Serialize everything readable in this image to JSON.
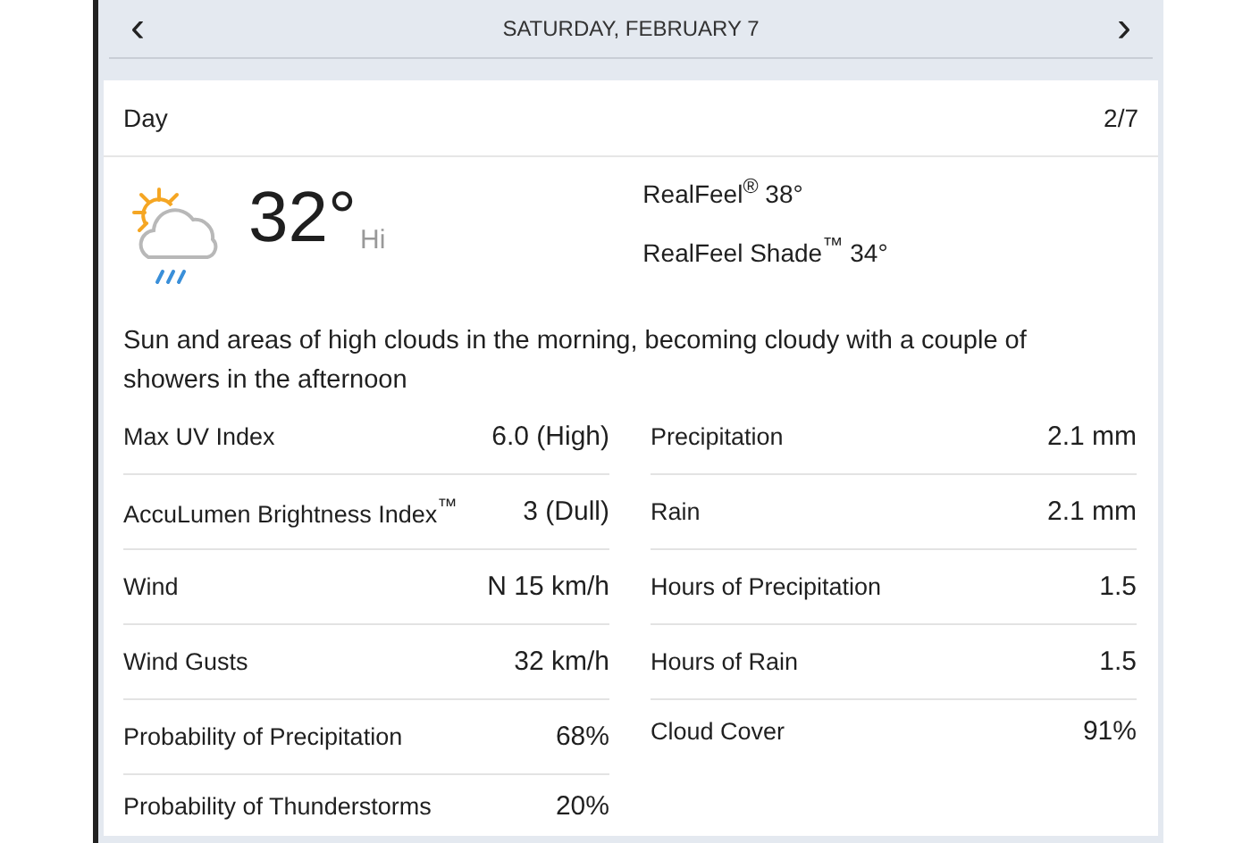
{
  "header": {
    "prev": "‹",
    "title": "SATURDAY, FEBRUARY 7",
    "next": "›"
  },
  "card": {
    "label": "Day",
    "page": "2/7",
    "temperature": "32°",
    "temperature_label": "Hi",
    "realfeel": [
      "RealFeel$^{®}$ 38°",
      "RealFeel Shade$^{™}$ 34°"
    ],
    "description": "Sun and areas of high clouds in the morning, becoming cloudy with a couple of showers in the afternoon",
    "details_left": [
      {
        "label": "Max UV Index",
        "value": "6.0 (High)"
      },
      {
        "label": "AccuLumen Brightness Index$^{™}$",
        "value": "3 (Dull)"
      },
      {
        "label": "Wind",
        "value": "N 15 km/h"
      },
      {
        "label": "Wind Gusts",
        "value": "32 km/h"
      },
      {
        "label": "Probability of Precipitation",
        "value": "68%"
      },
      {
        "label": "Probability of Thunderstorms",
        "value": "20%"
      }
    ],
    "details_right": [
      {
        "label": "Precipitation",
        "value": "2.1 mm"
      },
      {
        "label": "Rain",
        "value": "2.1 mm"
      },
      {
        "label": "Hours of Precipitation",
        "value": "1.5"
      },
      {
        "label": "Hours of Rain",
        "value": "1.5"
      },
      {
        "label": "Cloud Cover",
        "value": "91%"
      }
    ]
  }
}
